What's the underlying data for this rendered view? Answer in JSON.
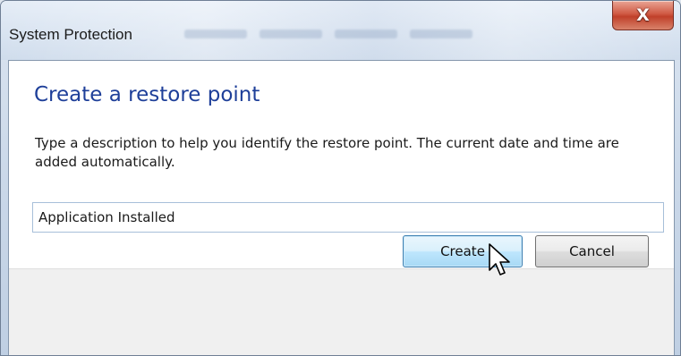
{
  "window": {
    "title": "System Protection",
    "close_symbol": "X"
  },
  "dialog": {
    "heading": "Create a restore point",
    "description": "Type a description to help you identify the restore point. The current date and time are added automatically.",
    "description_input": {
      "value": "Application Installed"
    }
  },
  "buttons": {
    "create_label": "Create",
    "cancel_label": "Cancel"
  },
  "colors": {
    "heading": "#1e3f99",
    "close_button": "#c0402a",
    "create_button_border": "#3c7fb1"
  },
  "icons": {
    "close": "close-icon",
    "cursor": "mouse-pointer-icon"
  }
}
